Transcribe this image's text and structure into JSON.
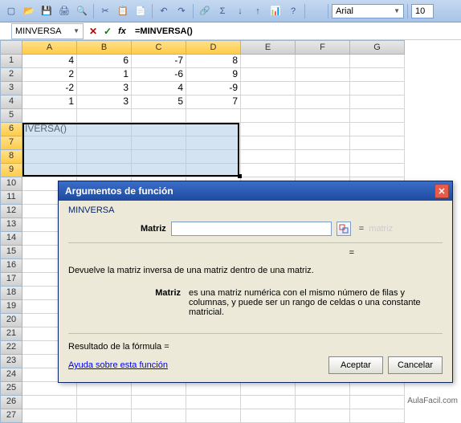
{
  "toolbar": {
    "font": "Arial",
    "size": "10"
  },
  "formulaBar": {
    "nameBox": "MINVERSA",
    "formula": "=MINVERSA()"
  },
  "columns": [
    "A",
    "B",
    "C",
    "D",
    "E",
    "F",
    "G"
  ],
  "rows": [
    "1",
    "2",
    "3",
    "4",
    "5",
    "6",
    "7",
    "8",
    "9",
    "10",
    "11",
    "12",
    "13",
    "14",
    "15",
    "16",
    "17",
    "18",
    "19",
    "20",
    "21",
    "22",
    "23",
    "24",
    "25",
    "26",
    "27"
  ],
  "cells": {
    "A1": "4",
    "B1": "6",
    "C1": "-7",
    "D1": "8",
    "A2": "2",
    "B2": "1",
    "C2": "-6",
    "D2": "9",
    "A3": "-2",
    "B3": "3",
    "C3": "4",
    "D3": "-9",
    "A4": "1",
    "B4": "3",
    "C4": "5",
    "D4": "7",
    "A6": "IVERSA()"
  },
  "dialog": {
    "title": "Argumentos de función",
    "funcName": "MINVERSA",
    "paramLabel": "Matriz",
    "paramValue": "",
    "paramHint": "matriz",
    "desc1": "Devuelve la matriz inversa de una matriz dentro de una matriz.",
    "desc2Label": "Matriz",
    "desc2Text": "es una matriz numérica con el mismo número de filas y columnas, y puede ser un rango de celdas o una constante matricial.",
    "resultLabel": "Resultado de la fórmula =",
    "helpLink": "Ayuda sobre esta función",
    "accept": "Aceptar",
    "cancel": "Cancelar"
  },
  "watermark": "AulaFacil.com"
}
